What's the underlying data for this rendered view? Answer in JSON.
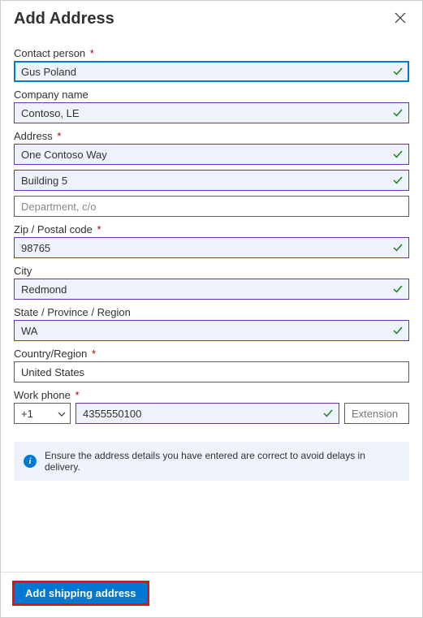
{
  "header": {
    "title": "Add Address"
  },
  "labels": {
    "contact": "Contact person",
    "company": "Company name",
    "address": "Address",
    "zip": "Zip / Postal code",
    "city": "City",
    "state": "State / Province / Region",
    "country": "Country/Region",
    "phone": "Work phone"
  },
  "values": {
    "contact": "Gus Poland",
    "company": "Contoso, LE",
    "addr1": "One Contoso Way",
    "addr2": "Building 5",
    "addr3": "",
    "zip": "98765",
    "city": "Redmond",
    "state": "WA",
    "country": "United States",
    "countryCode": "+1",
    "phone": "4355550100",
    "ext": ""
  },
  "placeholders": {
    "addr3": "Department, c/o",
    "ext": "Extension"
  },
  "info": {
    "message": "Ensure the address details you have entered are correct to avoid delays in delivery."
  },
  "footer": {
    "submit": "Add shipping address"
  }
}
